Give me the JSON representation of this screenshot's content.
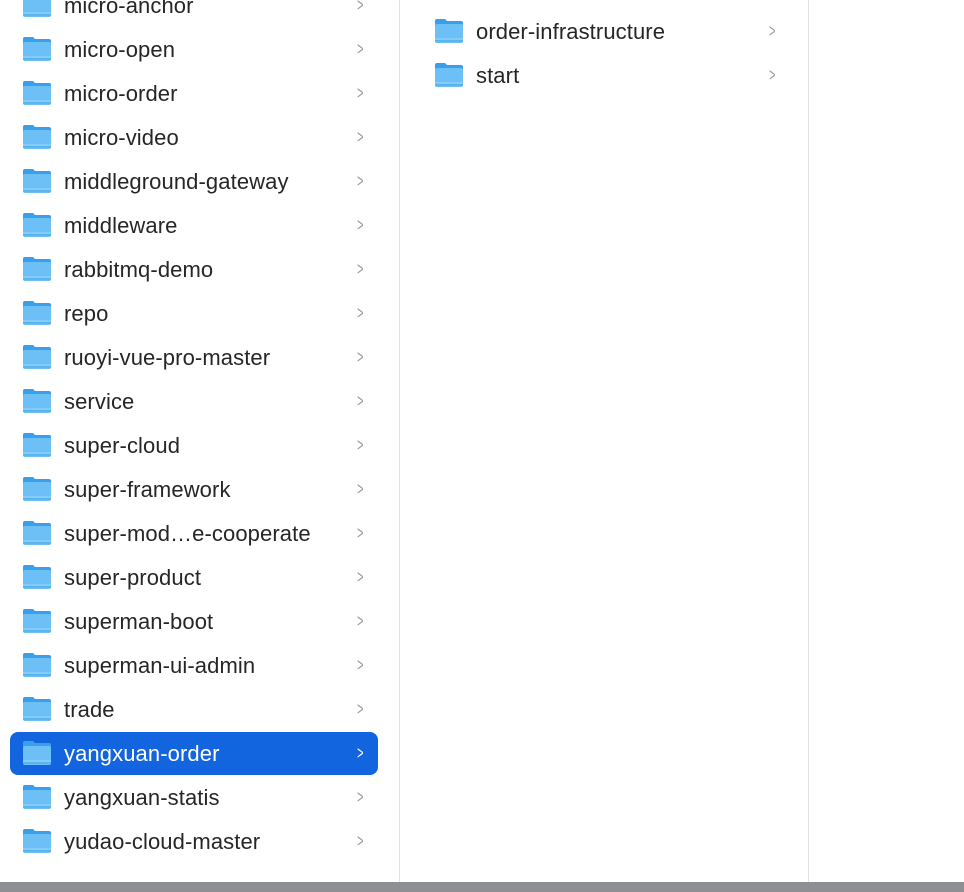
{
  "columns": [
    {
      "items": [
        {
          "label": "micro-anchor"
        },
        {
          "label": "micro-open"
        },
        {
          "label": "micro-order"
        },
        {
          "label": "micro-video"
        },
        {
          "label": "middleground-gateway"
        },
        {
          "label": "middleware"
        },
        {
          "label": "rabbitmq-demo"
        },
        {
          "label": "repo"
        },
        {
          "label": "ruoyi-vue-pro-master"
        },
        {
          "label": "service"
        },
        {
          "label": "super-cloud"
        },
        {
          "label": "super-framework"
        },
        {
          "label": "super-mod…e-cooperate"
        },
        {
          "label": "super-product"
        },
        {
          "label": "superman-boot"
        },
        {
          "label": "superman-ui-admin"
        },
        {
          "label": "trade"
        },
        {
          "label": "yangxuan-order",
          "selected": true
        },
        {
          "label": "yangxuan-statis"
        },
        {
          "label": "yudao-cloud-master"
        }
      ]
    },
    {
      "items": [
        {
          "label": ""
        },
        {
          "label": "order-infrastructure"
        },
        {
          "label": "start"
        }
      ]
    }
  ],
  "colors": {
    "selection": "#1265de",
    "folder": "#6cc0f5",
    "folder_tab": "#3a9ee8"
  }
}
